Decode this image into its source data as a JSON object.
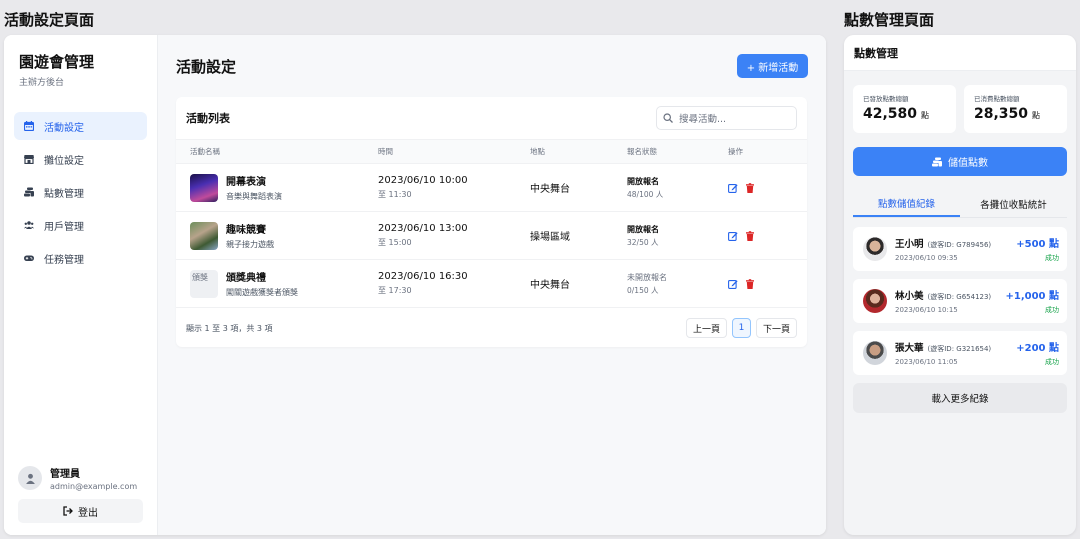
{
  "section_titles": {
    "left": "活動設定頁面",
    "right": "點數管理頁面"
  },
  "sidebar": {
    "brand_title": "園遊會管理",
    "brand_sub": "主辦方後台",
    "items": [
      {
        "label": "活動設定",
        "icon": "calendar-icon",
        "active": true
      },
      {
        "label": "攤位設定",
        "icon": "store-icon",
        "active": false
      },
      {
        "label": "點數管理",
        "icon": "coins-icon",
        "active": false
      },
      {
        "label": "用戶管理",
        "icon": "users-icon",
        "active": false
      },
      {
        "label": "任務管理",
        "icon": "gamepad-icon",
        "active": false
      }
    ],
    "user": {
      "name": "管理員",
      "email": "admin@example.com"
    },
    "logout_label": "登出"
  },
  "main": {
    "title": "活動設定",
    "add_button": "+ 新增活動",
    "list_title": "活動列表",
    "search_placeholder": "搜尋活動...",
    "columns": [
      "活動名稱",
      "時間",
      "地點",
      "報名狀態",
      "操作"
    ],
    "rows": [
      {
        "name": "開幕表演",
        "desc": "音樂與舞蹈表演",
        "time": "2023/06/10 10:00",
        "end": "至 11:30",
        "place": "中央舞台",
        "status": "開放報名",
        "count": "48/100 人",
        "thumb_alt": ""
      },
      {
        "name": "趣味競賽",
        "desc": "親子接力遊戲",
        "time": "2023/06/10 13:00",
        "end": "至 15:00",
        "place": "操場區域",
        "status": "開放報名",
        "count": "32/50 人",
        "thumb_alt": ""
      },
      {
        "name": "頒獎典禮",
        "desc": "闖關遊戲獲獎者頒獎",
        "time": "2023/06/10 16:30",
        "end": "至 17:30",
        "place": "中央舞台",
        "status": "未開放報名",
        "count": "0/150 人",
        "thumb_alt": "頒獎"
      }
    ],
    "footer_info": "顯示 1 至 3 項，共 3 項",
    "pager": {
      "prev": "上一頁",
      "current": "1",
      "next": "下一頁"
    }
  },
  "points": {
    "header": "點數管理",
    "stats": [
      {
        "label": "已發放點數總額",
        "value": "42,580",
        "unit": "點"
      },
      {
        "label": "已消費點數總額",
        "value": "28,350",
        "unit": "點"
      }
    ],
    "topup_label": "儲值點數",
    "tabs": [
      "點數儲值紀錄",
      "各攤位收點統計"
    ],
    "records": [
      {
        "name": "王小明",
        "id": "(遊客ID: G789456)",
        "time": "2023/06/10 09:35",
        "amount": "+500 點",
        "status": "成功"
      },
      {
        "name": "林小美",
        "id": "(遊客ID: G654123)",
        "time": "2023/06/10 10:15",
        "amount": "+1,000 點",
        "status": "成功"
      },
      {
        "name": "張大華",
        "id": "(遊客ID: G321654)",
        "time": "2023/06/10 11:05",
        "amount": "+200 點",
        "status": "成功"
      }
    ],
    "load_more": "載入更多紀錄"
  },
  "colors": {
    "accent": "#3b82f6",
    "danger": "#dc2626",
    "success": "#16a34a"
  }
}
